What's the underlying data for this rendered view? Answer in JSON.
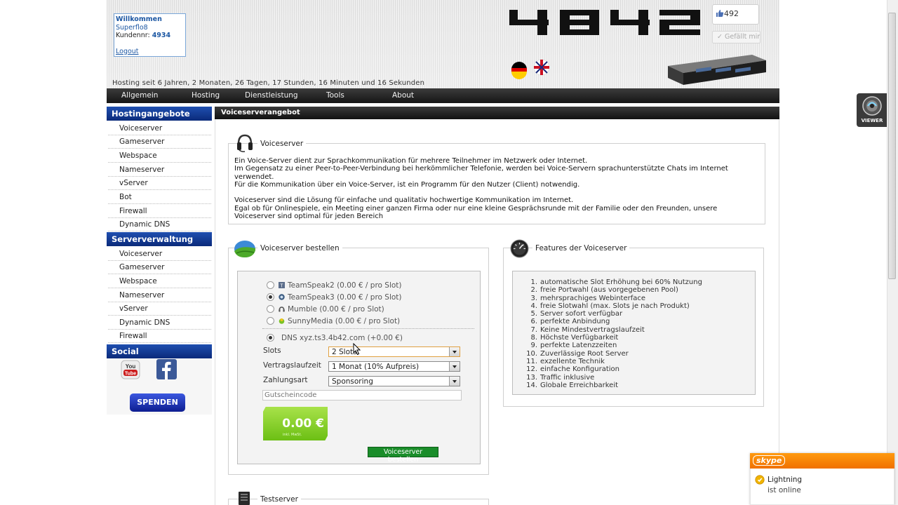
{
  "header": {
    "welcome": "Willkommen",
    "username": "Superflo8",
    "customer_label": "Kundennr:",
    "customer_number": "4934",
    "logout": "Logout",
    "hosting_since": "Hosting seit 6 Jahren, 2 Monaten, 26 Tagen, 17 Stunden, 16 Minuten und 16 Sekunden",
    "like_count": "492",
    "like_button": "Gefällt mir"
  },
  "nav": {
    "items": [
      "Allgemein",
      "Hosting",
      "Dienstleistung",
      "Tools",
      "About"
    ]
  },
  "sidebar": {
    "hosting_title": "Hostingangebote",
    "hosting_items": [
      "Voiceserver",
      "Gameserver",
      "Webspace",
      "Nameserver",
      "vServer",
      "Bot",
      "Firewall",
      "Dynamic DNS"
    ],
    "server_title": "Serververwaltung",
    "server_items": [
      "Voiceserver",
      "Gameserver",
      "Webspace",
      "Nameserver",
      "vServer",
      "Dynamic DNS",
      "Firewall"
    ],
    "social_title": "Social",
    "donate_button": "SPENDEN"
  },
  "content": {
    "bar_title": "Voiceserverangebot",
    "voiceserver_title": "Voiceserver",
    "description": [
      "Ein Voice-Server dient zur Sprachkommunikation für mehrere Teilnehmer im Netzwerk oder Internet.",
      "Im Gegensatz zu einer Peer-to-Peer-Verbindung bei herkömmlicher Telefonie, werden bei Voice-Servern sprachunterstützte Chats im Internet",
      "verwendet.",
      "Für die Kommunikation über ein Voice-Server, ist ein Programm für den Nutzer (Client) notwendig.",
      "",
      "Voiceserver sind die Lösung für einfache und qualitativ hochwertige Kommunikation im Internet.",
      "Egal ob für Onlinespiele, ein Meeting einer ganzen Firma oder nur eine kleine Gesprächsrunde mit der Familie oder den Freunden, unsere",
      "Voiceserver sind optimal für jeden Bereich"
    ],
    "order": {
      "title": "Voiceserver bestellen",
      "options": [
        {
          "label": "TeamSpeak2 (0.00 € / pro Slot)",
          "selected": false
        },
        {
          "label": "TeamSpeak3 (0.00 € / pro Slot)",
          "selected": true
        },
        {
          "label": "Mumble (0.00 € / pro Slot)",
          "selected": false
        },
        {
          "label": "SunnyMedia (0.00 € / pro Slot)",
          "selected": false
        }
      ],
      "dns_label": "DNS xyz.ts3.4b42.com (+0.00 €)",
      "slots_label": "Slots",
      "slots_value": "2 Slots",
      "term_label": "Vertragslaufzeit",
      "term_value": "1 Monat (10% Aufpreis)",
      "payment_label": "Zahlungsart",
      "payment_value": "Sponsoring",
      "coupon_placeholder": "Gutscheincode",
      "price": "0.00 €",
      "price_sub": "inkl. MwSt.",
      "submit": "Voiceserver bestellen"
    },
    "features": {
      "title": "Features der Voiceserver",
      "items": [
        "automatische Slot Erhöhung bei 60% Nutzung",
        "freie Portwahl (aus vorgegebenen Pool)",
        "mehrsprachiges Webinterface",
        "freie Slotwahl (max. Slots je nach Produkt)",
        "Server sofort verfügbar",
        "perfekte Anbindung",
        "Keine Mindestvertragslaufzeit",
        "Höchste Verfügbarkeit",
        "perfekte Latenzzeiten",
        "Zuverlässige Root Server",
        "exzellente Technik",
        "einfache Konfiguration",
        "Traffic inklusive",
        "Globale Erreichbarkeit"
      ]
    },
    "testserver_title": "Testserver"
  },
  "widgets": {
    "viewer_label": "VIEWER",
    "skype_logo": "skype",
    "skype_name": "Lightning",
    "skype_status": "ist online"
  },
  "colors": {
    "sidebar_header": "#0b2a7a",
    "nav_bar": "#151515",
    "price_green": "#7ccb1c",
    "submit_green": "#1a8d2a",
    "skype_orange": "#f07000",
    "link_blue": "#1c57a3"
  }
}
